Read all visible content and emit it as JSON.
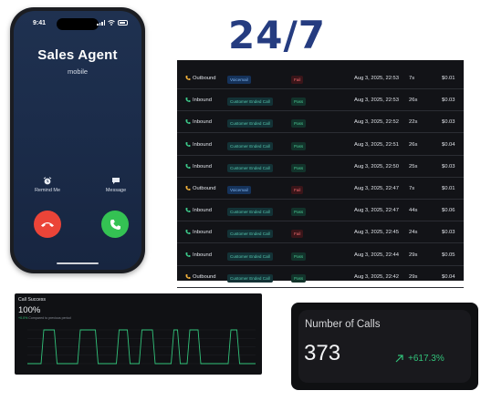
{
  "phone": {
    "status_time": "9:41",
    "caller_name": "Sales Agent",
    "caller_subtitle": "mobile",
    "remind_label": "Remind Me",
    "message_label": "Message"
  },
  "heading": "24/7",
  "call_log": [
    {
      "direction": "Outbound",
      "reason": "Voicemail",
      "status": "Fail",
      "date": "Aug 3, 2025, 22:53",
      "duration": "7s",
      "cost": "$0.01"
    },
    {
      "direction": "Inbound",
      "reason": "Customer Ended Call",
      "status": "Pass",
      "date": "Aug 3, 2025, 22:53",
      "duration": "26s",
      "cost": "$0.03"
    },
    {
      "direction": "Inbound",
      "reason": "Customer Ended Call",
      "status": "Pass",
      "date": "Aug 3, 2025, 22:52",
      "duration": "22s",
      "cost": "$0.03"
    },
    {
      "direction": "Inbound",
      "reason": "Customer Ended Call",
      "status": "Pass",
      "date": "Aug 3, 2025, 22:51",
      "duration": "26s",
      "cost": "$0.04"
    },
    {
      "direction": "Inbound",
      "reason": "Customer Ended Call",
      "status": "Pass",
      "date": "Aug 3, 2025, 22:50",
      "duration": "25s",
      "cost": "$0.03"
    },
    {
      "direction": "Outbound",
      "reason": "Voicemail",
      "status": "Fail",
      "date": "Aug 3, 2025, 22:47",
      "duration": "7s",
      "cost": "$0.01"
    },
    {
      "direction": "Inbound",
      "reason": "Customer Ended Call",
      "status": "Pass",
      "date": "Aug 3, 2025, 22:47",
      "duration": "44s",
      "cost": "$0.06"
    },
    {
      "direction": "Inbound",
      "reason": "Customer Ended Call",
      "status": "Fail",
      "date": "Aug 3, 2025, 22:45",
      "duration": "24s",
      "cost": "$0.03"
    },
    {
      "direction": "Inbound",
      "reason": "Customer Ended Call",
      "status": "Pass",
      "date": "Aug 3, 2025, 22:44",
      "duration": "29s",
      "cost": "$0.05"
    },
    {
      "direction": "Outbound",
      "reason": "Customer Ended Call",
      "status": "Pass",
      "date": "Aug 3, 2025, 22:42",
      "duration": "29s",
      "cost": "$0.04"
    }
  ],
  "call_success": {
    "title": "Call Success",
    "value": "100%",
    "change": "+0.0%",
    "change_note": "Compared to previous period",
    "pulse_starts": [
      0.06,
      0.22,
      0.39,
      0.49,
      0.63,
      0.7,
      0.88
    ],
    "pulse_widths": [
      0.07,
      0.09,
      0.06,
      0.07,
      0.04,
      0.06,
      0.05
    ]
  },
  "number_of_calls": {
    "label": "Number of Calls",
    "value": "373",
    "change": "+617.3%"
  },
  "colors": {
    "accent_green": "#32c27a",
    "fail_red": "#ef6b6e",
    "heading_blue": "#253c80"
  }
}
